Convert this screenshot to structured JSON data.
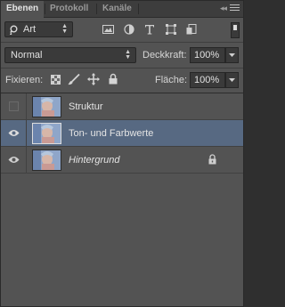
{
  "tabs": [
    {
      "label": "Ebenen",
      "active": true
    },
    {
      "label": "Protokoll",
      "active": false
    },
    {
      "label": "Kanäle",
      "active": false
    }
  ],
  "collapse_glyph": "◂◂",
  "filter": {
    "kind": "Art"
  },
  "blend": {
    "mode": "Normal",
    "opacity_label": "Deckkraft:",
    "opacity_value": "100%"
  },
  "lock": {
    "label": "Fixieren:",
    "fill_label": "Fläche:",
    "fill_value": "100%"
  },
  "layers": [
    {
      "name": "Struktur",
      "visible": false,
      "selected": false,
      "locked": false,
      "italic": false
    },
    {
      "name": "Ton- und Farbwerte",
      "visible": true,
      "selected": true,
      "locked": false,
      "italic": false
    },
    {
      "name": "Hintergrund",
      "visible": true,
      "selected": false,
      "locked": true,
      "italic": true
    }
  ],
  "colors": {
    "panel": "#535353",
    "selection": "#576982",
    "field": "#3a3a3a"
  }
}
